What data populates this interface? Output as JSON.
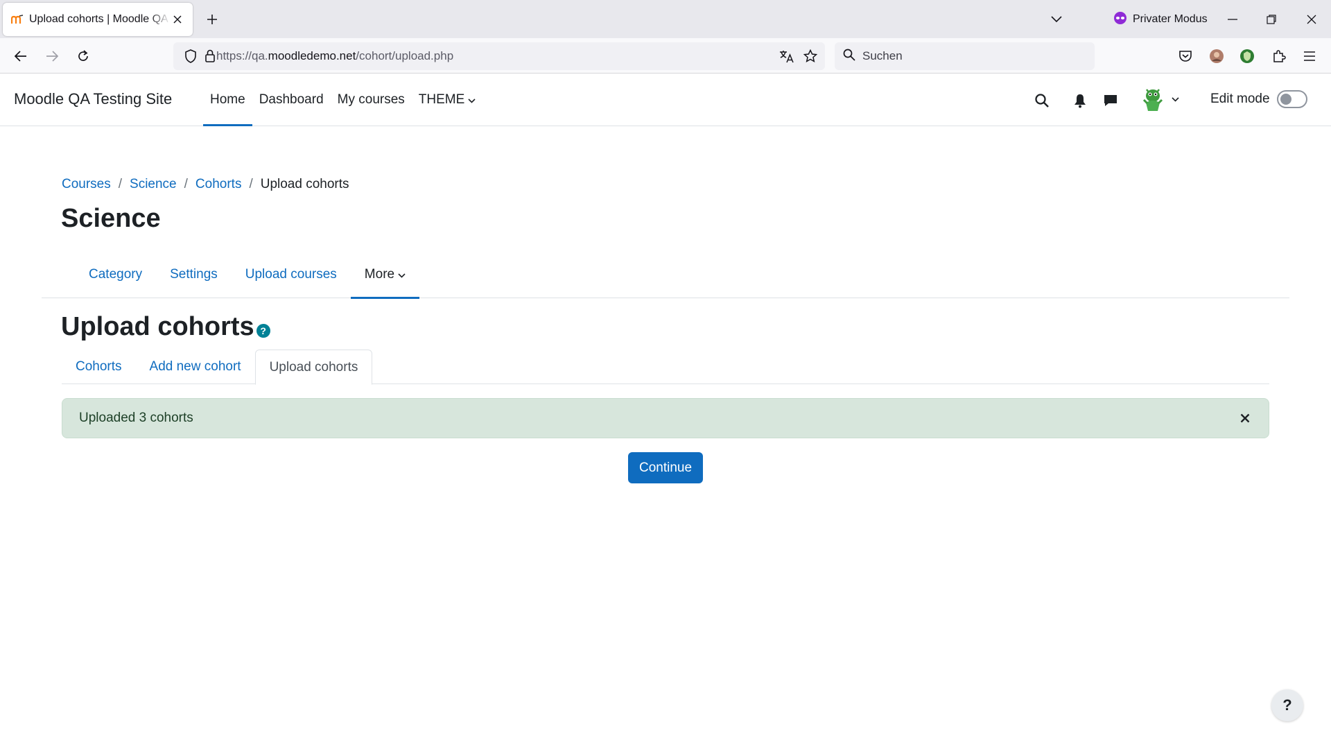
{
  "browser": {
    "tab_title": "Upload cohorts | Moodle QA Testing Site",
    "private_mode_label": "Privater Modus",
    "url_prefix": "https://qa.",
    "url_host": "moodledemo.net",
    "url_path": "/cohort/upload.php",
    "search_placeholder": "Suchen"
  },
  "navbar": {
    "site_name": "Moodle QA Testing Site",
    "items": [
      {
        "label": "Home",
        "active": true
      },
      {
        "label": "Dashboard"
      },
      {
        "label": "My courses"
      },
      {
        "label": "THEME"
      }
    ],
    "edit_mode_label": "Edit mode"
  },
  "breadcrumb": [
    "Courses",
    "Science",
    "Cohorts",
    "Upload cohorts"
  ],
  "page_title": "Science",
  "secondary_nav": [
    {
      "label": "Category"
    },
    {
      "label": "Settings"
    },
    {
      "label": "Upload courses"
    },
    {
      "label": "More",
      "active": true
    }
  ],
  "heading": "Upload cohorts",
  "tabs": [
    {
      "label": "Cohorts"
    },
    {
      "label": "Add new cohort"
    },
    {
      "label": "Upload cohorts",
      "active": true
    }
  ],
  "alert": {
    "message": "Uploaded 3 cohorts",
    "color": "#d7e6dc"
  },
  "continue_label": "Continue",
  "footer_help_label": "?",
  "colors": {
    "primary": "#0f6cbf",
    "help_icon": "#008196"
  }
}
